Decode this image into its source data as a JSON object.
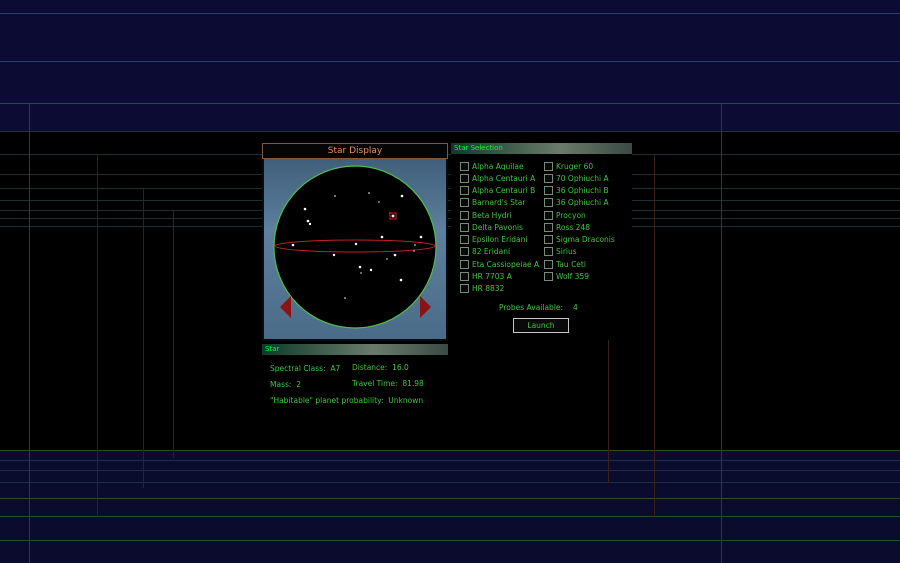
{
  "star_display": {
    "title": "Star Display"
  },
  "star_selection": {
    "title": "Star Selection",
    "col1": [
      "Alpha Aquilae",
      "Alpha Centauri A",
      "Alpha Centauri B",
      "Barnard's Star",
      "Beta Hydri",
      "Delta Pavonis",
      "Epsilon Eridani",
      "82 Eridani",
      "Eta Cassiopeiae A",
      "HR 7703 A",
      "HR 8832"
    ],
    "col2": [
      "Kruger 60",
      "70 Ophiuchi A",
      "36 Ophiuchi B",
      "36 Ophiuchi A",
      "Procyon",
      "Ross 248",
      "Sigma Draconis",
      "Sirius",
      "Tau Ceti",
      "Wolf 359"
    ],
    "probes_label": "Probes Available:",
    "probes_value": "4",
    "launch_label": "Launch"
  },
  "star_info": {
    "title": "Star",
    "spectral_label": "Spectral Class:",
    "spectral_value": "A7",
    "distance_label": "Distance:",
    "distance_value": "16.0",
    "mass_label": "Mass:",
    "mass_value": "2",
    "travel_label": "Travel Time:",
    "travel_value": "81.98",
    "habitable_label": "\"Habitable\" planet probability:",
    "habitable_value": "Unknown"
  },
  "colors": {
    "text_green": "#3fc43f",
    "title_orange": "#e89060",
    "globe_outline": "#4fbf4f",
    "equator_red": "#c02020",
    "arrow_red": "#8a1414",
    "background_navy": "#0b0b33"
  },
  "icons": {
    "left": "left-arrow-icon",
    "right": "right-arrow-icon",
    "checkbox": "checkbox-icon",
    "selected_star": "selected-star-marker-icon"
  }
}
